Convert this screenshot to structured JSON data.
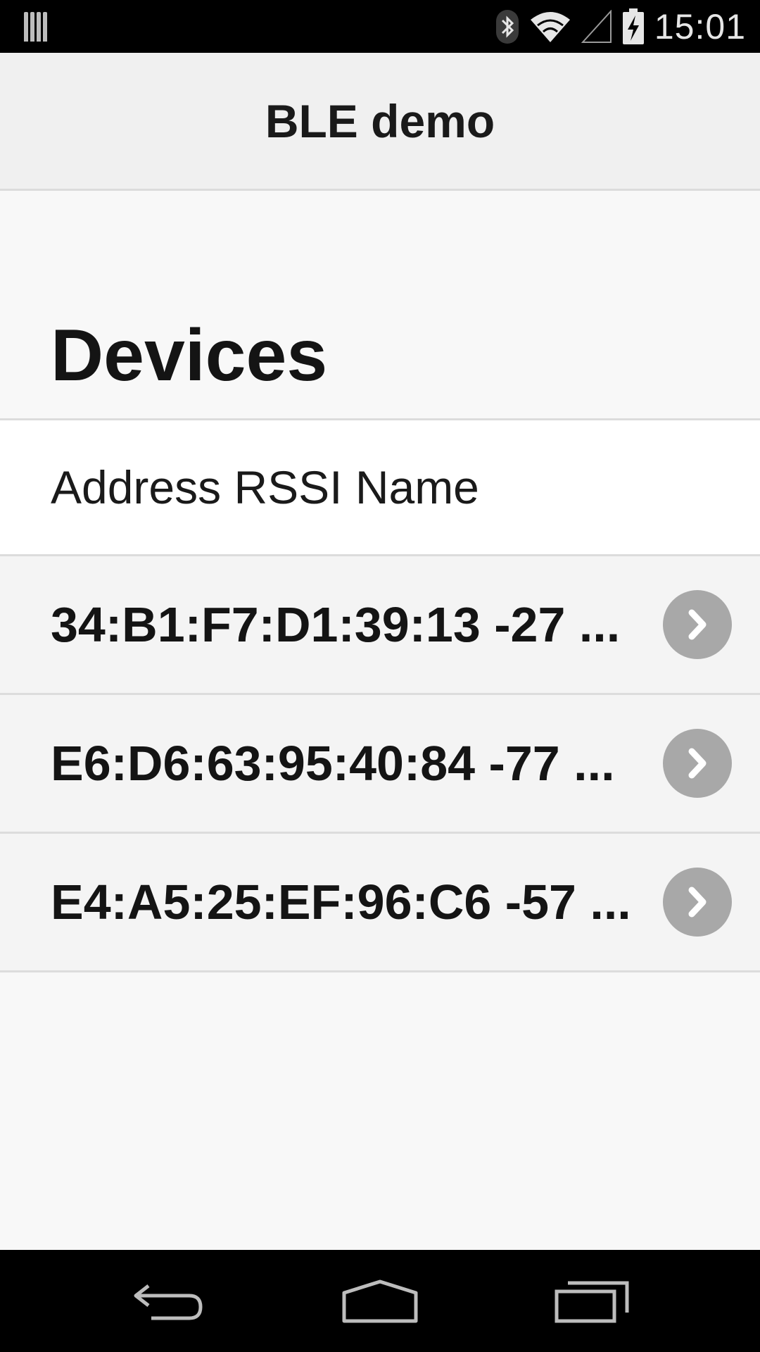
{
  "status_bar": {
    "time": "15:01",
    "icons": [
      "notification-bars-icon",
      "bluetooth-icon",
      "wifi-icon",
      "cell-signal-icon",
      "battery-charging-icon"
    ]
  },
  "action_bar": {
    "title": "BLE demo"
  },
  "content": {
    "section_title": "Devices",
    "column_header": "Address RSSI Name",
    "devices": [
      {
        "label": "34:B1:F7:D1:39:13 -27 ...",
        "icon": "chevron-right-icon"
      },
      {
        "label": "E6:D6:63:95:40:84 -77 ...",
        "icon": "chevron-right-icon"
      },
      {
        "label": "E4:A5:25:EF:96:C6 -57 ...",
        "icon": "chevron-right-icon"
      }
    ]
  },
  "nav_bar": {
    "icons": [
      "back-icon",
      "home-icon",
      "recents-icon"
    ]
  },
  "colors": {
    "status_bar_bg": "#000000",
    "action_bar_bg": "#f0f0f0",
    "page_bg": "#f8f8f8",
    "chevron_bg": "#a8a8a8",
    "text": "#141414"
  }
}
